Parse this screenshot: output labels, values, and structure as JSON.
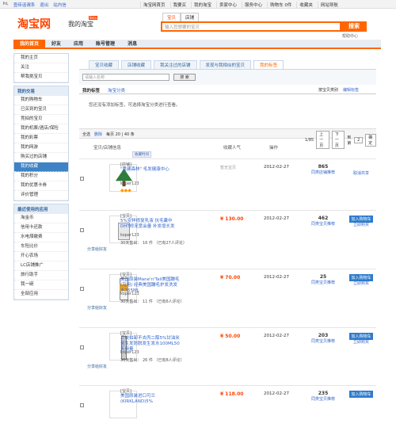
{
  "topbar": {
    "left": [
      "hi,",
      "壹砖谣谓系",
      "退出",
      "站内信"
    ],
    "right": [
      "淘宝网首页",
      "我要买",
      "我的淘宝",
      "卖家中心",
      "服务中心",
      "购物车 0件",
      "收藏夹",
      "网站导航"
    ]
  },
  "header": {
    "logo": "淘宝网",
    "subtitle": "我的淘宝",
    "beta": "Beta",
    "search_tabs": [
      "宝贝",
      "店铺"
    ],
    "search_placeholder": "输入您想要的宝贝",
    "search_button": "搜索",
    "help": "帮助中心"
  },
  "mainnav": [
    "我的首页",
    "好友",
    "应用",
    "账号管理",
    "消息"
  ],
  "sidebar": {
    "box1": [
      "我的主页",
      "关注",
      "帮我挑宝贝"
    ],
    "box2_title": "我的交易",
    "box2": [
      "我的购物车",
      "已买到的宝贝",
      "竞拍的宝贝",
      "我的机票/酒店/保险",
      "我的彩票",
      "我的网游",
      "购买过的店铺",
      "我的收藏",
      "我的积分",
      "我的优惠卡券",
      "评价管理"
    ],
    "box3_title": "最近使用的应用",
    "apps": [
      "淘金币",
      "信用卡还款",
      "水电煤缴费",
      "车险比价",
      "开心农场",
      "LC店铺推广",
      "旅行助手",
      "我一碗"
    ],
    "more": "全部应用"
  },
  "content": {
    "tabs": [
      "宝贝收藏",
      "店铺收藏",
      "我关注过的店铺",
      "发现与我相似的宝贝",
      "我的标签"
    ],
    "filter_placeholder": "请输入名称",
    "filter_button": "搜 索",
    "list_tabs": [
      "我的标签",
      "淘宝分类"
    ],
    "list_right": [
      "按宝贝类别",
      "编辑标签"
    ],
    "tip": "您还没有添加标签，可选择淘宝分类进行查看。",
    "opbar": {
      "select_all": "全选",
      "delete": "删除",
      "per_page": "每页 20 | 40 条",
      "page": "1/85",
      "prev": "上一页",
      "next": "下一页",
      "goto": "到第",
      "page_input": "2",
      "go": "确定"
    },
    "thead": [
      "宝贝/店铺信息",
      "收藏人气",
      "收藏时间",
      "操作"
    ],
    "recent_tag": "收藏时间"
  },
  "rows": [
    {
      "tag": "[店铺]",
      "title": "\"重建森林\" 毛发健康中心",
      "seller": "koper123",
      "note": "暂无宝贝",
      "date": "2012-02-27",
      "count": "865",
      "rec": "同类店铺推荐",
      "act1": "",
      "act2": "取消共享",
      "share": "",
      "ship": "",
      "price": "",
      "diamonds": "◆◆◆"
    },
    {
      "tag": "[宝贝]",
      "title": "5%安样修复乳液 抗毛囊中DHT修宠宽会量 补发增长发",
      "seller": "koper123",
      "price": "¥ 130.00",
      "date": "2012-02-27",
      "count": "462",
      "rec": "同类宝贝推荐",
      "act1": "加入购物车",
      "act2": "立即购买",
      "share": "分享给好友",
      "ship": "30天售出： 16 件 （已有27人评论）",
      "note": "",
      "diamonds": ""
    },
    {
      "tag": "[宝贝]",
      "title": "美国原装Mane'n'Tail美国蹦毛(马用) 经典美国蹦毛护发洗发水355ML",
      "seller": "koper123",
      "price": "¥ 70.00",
      "date": "2012-02-27",
      "count": "25",
      "rec": "同类宝贝推荐",
      "act1": "加入购物车",
      "act2": "立即购买",
      "share": "分享给好友",
      "ship": "30天售出： 11 件 （已有6人评论）",
      "note": "",
      "diamonds": ""
    },
    {
      "tag": "[宝贝]",
      "title": "三枝拍卸不去丙二醇5%甘油米诺生发防脱发生发水100ML50天用量",
      "seller": "koper123",
      "price": "¥ 50.00",
      "date": "2012-02-27",
      "count": "203",
      "rec": "同类宝贝推荐",
      "act1": "加入购物车",
      "act2": "立即购买",
      "share": "分享给好友",
      "ship": "30天售出： 26 件 （已有8人评论）",
      "note": "",
      "diamonds": ""
    },
    {
      "tag": "[宝贝]",
      "title": "美国原装进口可兰(KIRKLAND)5%",
      "seller": "",
      "price": "¥ 118.00",
      "date": "2012-02-27",
      "count": "235",
      "rec": "同类宝贝推荐",
      "act1": "加入购物车",
      "act2": "",
      "share": "",
      "ship": "",
      "note": "",
      "diamonds": ""
    }
  ],
  "colors": {
    "brand": "#ff4400",
    "accent": "#ff6600",
    "link": "#3366cc"
  }
}
